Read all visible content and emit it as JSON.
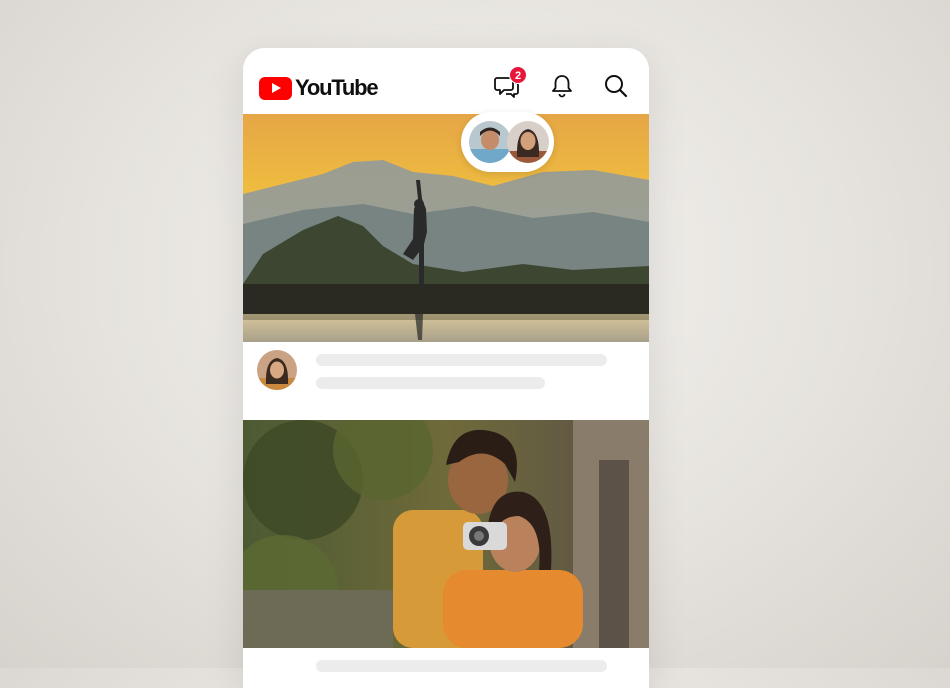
{
  "app": {
    "name": "YouTube",
    "brand_color": "#ff0000",
    "badge_color": "#e8173a"
  },
  "header": {
    "logo_text": "YouTube",
    "icons": [
      {
        "name": "chat-icon",
        "badge": "2"
      },
      {
        "name": "bell-icon"
      },
      {
        "name": "search-icon"
      }
    ]
  },
  "feed": {
    "items": [
      {
        "thumbnail": "yoga-silhouette-sunset-lake",
        "avatar": "woman-avatar",
        "shared_with": [
          "man-avatar",
          "woman-avatar"
        ],
        "title": "",
        "subtitle": ""
      },
      {
        "thumbnail": "couple-with-camera-outdoors"
      }
    ]
  }
}
